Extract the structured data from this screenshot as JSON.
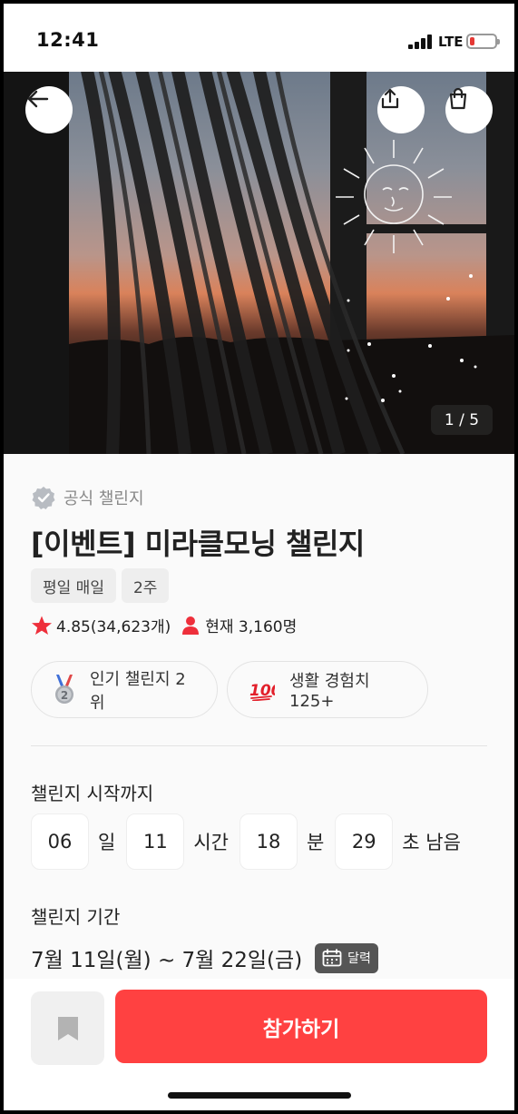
{
  "status_bar": {
    "time": "12:41",
    "network": "LTE",
    "battery_level": 0.1
  },
  "hero": {
    "page_counter": "1 / 5",
    "current_image": 1,
    "total_images": 5,
    "icons": {
      "back": "arrow-left-icon",
      "share": "share-icon",
      "cart": "shopping-bag-icon"
    }
  },
  "challenge": {
    "official_label": "공식 챌린지",
    "title": "[이벤트] 미라클모닝 챌린지",
    "tags": [
      "평일 매일",
      "2주"
    ],
    "rating": "4.85(34,623개)",
    "participants": "현재 3,160명",
    "badges": [
      {
        "icon": "silver-medal-icon",
        "label": "인기 챌린지 2위"
      },
      {
        "icon": "hundred-points-icon",
        "label": "생활 경험치 125+"
      }
    ]
  },
  "countdown": {
    "label": "챌린지 시작까지",
    "days": "06",
    "days_unit": "일",
    "hours": "11",
    "hours_unit": "시간",
    "minutes": "18",
    "minutes_unit": "분",
    "seconds": "29",
    "seconds_unit": "초 남음"
  },
  "period": {
    "label": "챌린지 기간",
    "value": "7월 11일(월) ~ 7월 22일(금)",
    "calendar_button": "달력"
  },
  "bottom": {
    "join_button": "참가하기"
  },
  "colors": {
    "accent": "#ff4141",
    "star": "#ee2f3b",
    "text": "#222222",
    "muted": "#888888"
  }
}
